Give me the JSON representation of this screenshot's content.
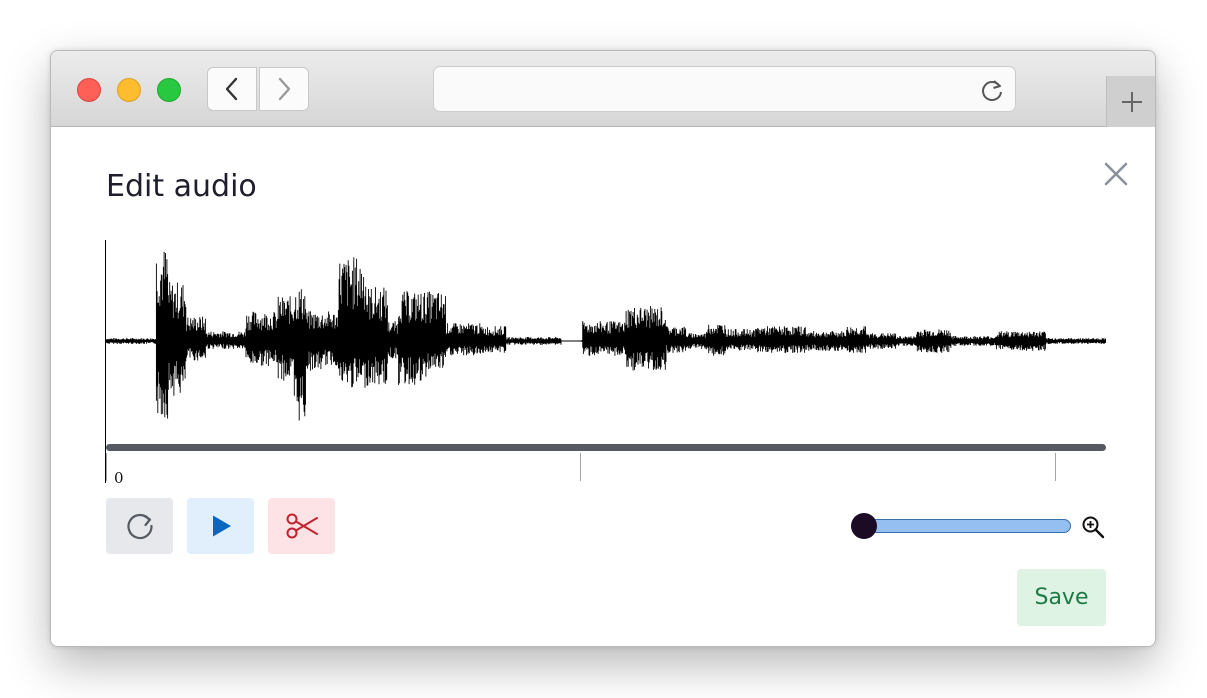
{
  "browser": {
    "back_icon": "chevron-left-icon",
    "forward_icon": "chevron-right-icon",
    "reload_icon": "reload-icon",
    "new_tab_icon": "plus-icon",
    "url": ""
  },
  "dialog": {
    "title": "Edit audio",
    "close_icon": "close-icon"
  },
  "timeline": {
    "tick_label": "0"
  },
  "controls": {
    "reset_icon": "reset-icon",
    "play_icon": "play-icon",
    "trim_icon": "scissors-icon",
    "zoom_level": 0,
    "zoom_icon": "zoom-in-icon"
  },
  "actions": {
    "save_label": "Save"
  },
  "colors": {
    "play_accent": "#0b66c2",
    "trim_accent": "#c0232e",
    "save_text": "#1b7b43",
    "slider_fill": "#94bff0",
    "slider_thumb": "#1c0b24"
  }
}
